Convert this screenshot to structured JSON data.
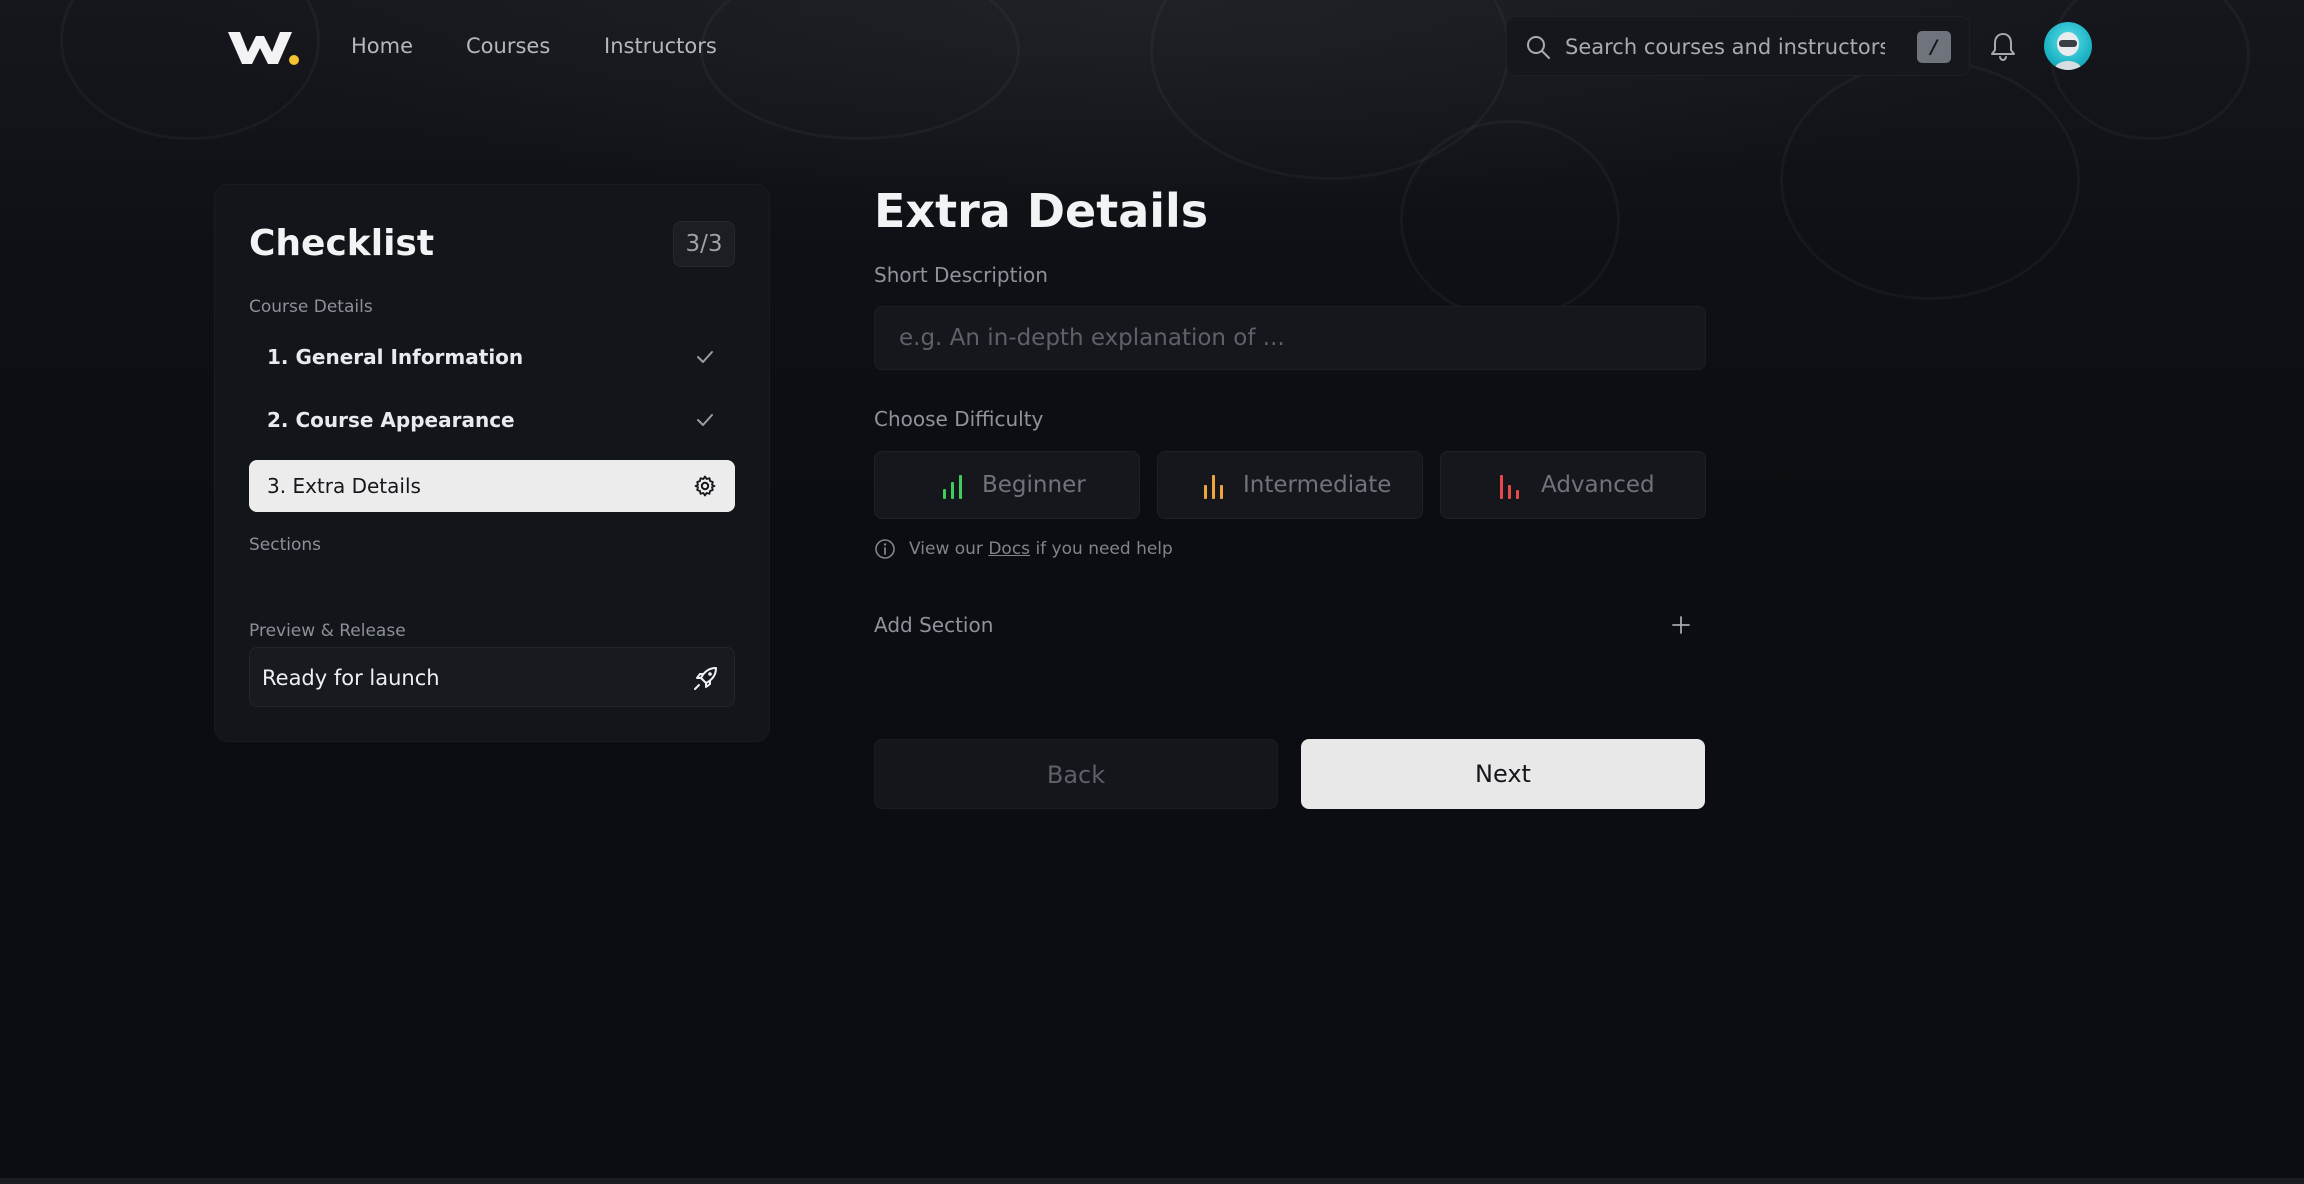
{
  "header": {
    "nav": [
      {
        "label": "Home"
      },
      {
        "label": "Courses"
      },
      {
        "label": "Instructors"
      }
    ],
    "search": {
      "placeholder": "Search courses and instructors",
      "shortcut": "/"
    }
  },
  "checklist": {
    "title": "Checklist",
    "progress": "3/3",
    "course_details_label": "Course Details",
    "steps": [
      {
        "label": "1. General Information",
        "status": "done",
        "icon": "check-icon"
      },
      {
        "label": "2. Course Appearance",
        "status": "done",
        "icon": "check-icon"
      },
      {
        "label": "3. Extra Details",
        "status": "active",
        "icon": "gear-icon"
      }
    ],
    "sections_label": "Sections",
    "preview_label": "Preview & Release",
    "launch": {
      "label": "Ready for launch",
      "icon": "rocket-icon"
    }
  },
  "form": {
    "title": "Extra Details",
    "short_description": {
      "label": "Short Description",
      "placeholder": "e.g. An in-depth explanation of ...",
      "value": ""
    },
    "difficulty": {
      "label": "Choose Difficulty",
      "options": [
        {
          "label": "Beginner",
          "color": "#3ecf5a"
        },
        {
          "label": "Intermediate",
          "color": "#f0a53a"
        },
        {
          "label": "Advanced",
          "color": "#e8484a"
        }
      ]
    },
    "help": {
      "prefix": "View our",
      "link": "Docs",
      "suffix": "if you need help"
    },
    "add_section": "Add Section",
    "back_label": "Back",
    "next_label": "Next"
  }
}
